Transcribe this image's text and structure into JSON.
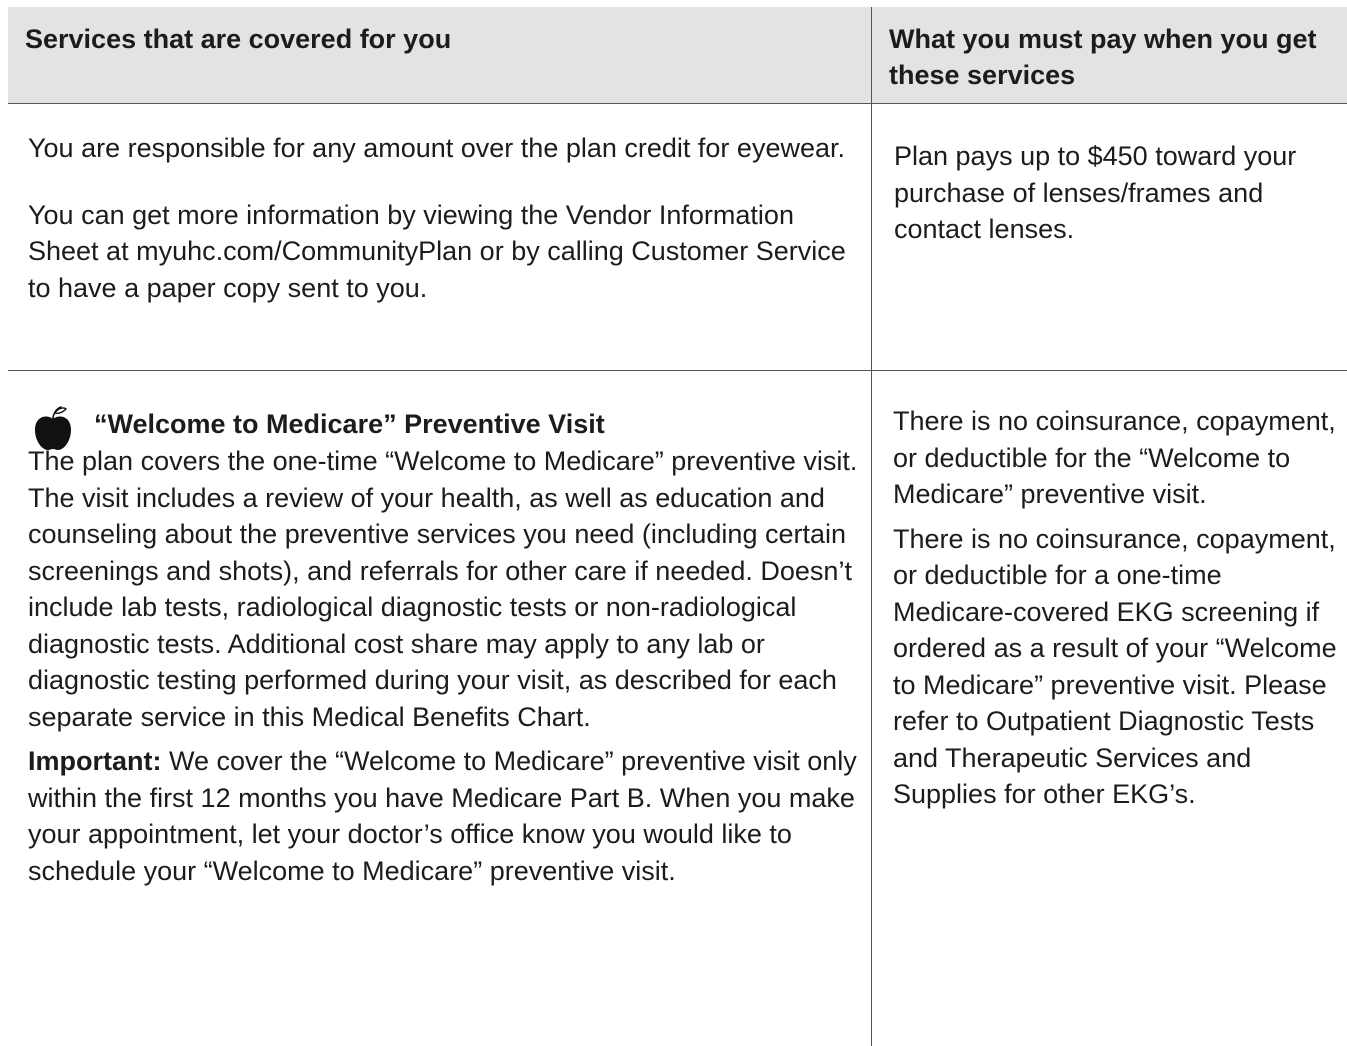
{
  "header": {
    "left": "Services that are covered for you",
    "right": "What you must pay when you get these services"
  },
  "rows": [
    {
      "left_paragraphs": [
        "You are responsible for any amount over the plan credit for eyewear.",
        "You can get more information by viewing the Vendor Information Sheet at myuhc.com/CommunityPlan or by calling Customer Service to have a paper copy sent to you."
      ],
      "right_paragraphs": [
        "Plan pays up to $450 toward your purchase of lenses/frames and contact lenses."
      ]
    },
    {
      "icon": "apple-icon",
      "title": "“Welcome to Medicare” Preventive Visit",
      "left_paragraphs": [
        "The plan covers the one-time “Welcome to Medicare” preventive visit. The visit includes a review of your health, as well as education and counseling about the preventive services you need (including certain screenings and shots), and referrals for other care if needed. Doesn’t include lab tests, radiological diagnostic tests or non-radiological diagnostic tests. Additional cost share may apply to any lab or diagnostic testing performed during your visit, as described for each separate service in this Medical Benefits Chart."
      ],
      "important_label": "Important:",
      "important_text": " We cover the “Welcome to Medicare” preventive visit only within the first 12 months you have Medicare Part B. When you make your appointment, let your doctor’s office know you would like to schedule your “Welcome to Medicare” preventive visit.",
      "right_paragraphs": [
        "There is no coinsurance, copayment, or deductible for the “Welcome to Medicare” preventive visit.",
        "There is no coinsurance, copayment, or deductible for a one-time Medicare-covered EKG screening if ordered as a result of your “Welcome to Medicare” preventive visit. Please refer to Outpatient Diagnostic Tests and Therapeutic Services and Supplies for other EKG’s."
      ]
    }
  ]
}
